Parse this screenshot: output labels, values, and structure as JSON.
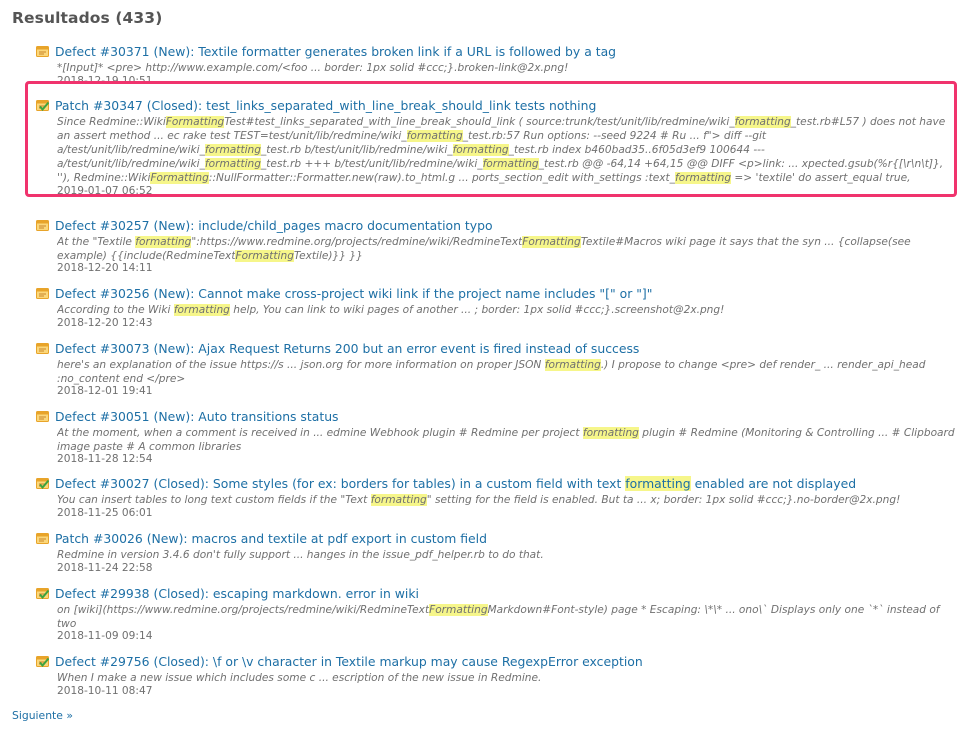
{
  "heading": "Resultados (433)",
  "results": [
    {
      "type": "issue",
      "title": [
        {
          "t": "Defect #30371 (New): Textile formatter generates broken link if a URL is followed by a tag"
        }
      ],
      "desc": [
        {
          "t": "*[Input]* <pre> http://www.example.com/<foo ... border: 1px solid #ccc;}.broken-link@2x.png!"
        }
      ],
      "date": "2018-12-19 10:51"
    },
    {
      "type": "closed",
      "title": [
        {
          "t": "Patch #30347 (Closed): test_links_separated_with_line_break_should_link tests nothing"
        }
      ],
      "desc": [
        {
          "t": "Since Redmine::Wiki"
        },
        {
          "t": "Formatting",
          "h": true
        },
        {
          "t": "Test#test_links_separated_with_line_break_should_link ( source:trunk/test/unit/lib/redmine/wiki_"
        },
        {
          "t": "formatting",
          "h": true
        },
        {
          "t": "_test.rb#L57 ) does not have an assert method ... ec rake test TEST=test/unit/lib/redmine/wiki_"
        },
        {
          "t": "formatting",
          "h": true
        },
        {
          "t": "_test.rb:57 Run options: --seed 9224 # Ru ... f\"> diff --git a/test/unit/lib/redmine/wiki_"
        },
        {
          "t": "formatting",
          "h": true
        },
        {
          "t": "_test.rb b/test/unit/lib/redmine/wiki_"
        },
        {
          "t": "formatting",
          "h": true
        },
        {
          "t": "_test.rb index b460bad35..6f05d3ef9 100644 --- a/test/unit/lib/redmine/wiki_"
        },
        {
          "t": "formatting",
          "h": true
        },
        {
          "t": "_test.rb +++ b/test/unit/lib/redmine/wiki_"
        },
        {
          "t": "formatting",
          "h": true
        },
        {
          "t": "_test.rb @@ -64,14 +64,15 @@ DIFF <p>link: ... xpected.gsub(%r{[\\r\\n\\t]}, ''), Redmine::Wiki"
        },
        {
          "t": "Formatting",
          "h": true
        },
        {
          "t": "::NullFormatter::Formatter.new(raw).to_html.g ... ports_section_edit with_settings :text_"
        },
        {
          "t": "formatting",
          "h": true
        },
        {
          "t": " => 'textile' do assert_equal true, Redmine::Wiki"
        },
        {
          "t": "Formatting",
          "h": true
        },
        {
          "t": "..."
        }
      ],
      "date": "2019-01-07 06:52"
    },
    {
      "type": "issue",
      "title": [
        {
          "t": "Defect #30257 (New): include/child_pages macro documentation typo"
        }
      ],
      "desc": [
        {
          "t": "At the \"Textile "
        },
        {
          "t": "formatting",
          "h": true
        },
        {
          "t": "\":https://www.redmine.org/projects/redmine/wiki/RedmineText"
        },
        {
          "t": "Formatting",
          "h": true
        },
        {
          "t": "Textile#Macros wiki page it says that the syn ... {collapse(see example) {{include(RedmineText"
        },
        {
          "t": "Formatting",
          "h": true
        },
        {
          "t": "Textile)}} }}"
        }
      ],
      "date": "2018-12-20 14:11"
    },
    {
      "type": "issue",
      "title": [
        {
          "t": "Defect #30256 (New): Cannot make cross-project wiki link if the project name includes \"[\" or \"]\""
        }
      ],
      "desc": [
        {
          "t": "According to the Wiki "
        },
        {
          "t": "formatting",
          "h": true
        },
        {
          "t": " help, You can link to wiki pages of another ... ; border: 1px solid #ccc;}.screenshot@2x.png!"
        }
      ],
      "date": "2018-12-20 12:43"
    },
    {
      "type": "issue",
      "title": [
        {
          "t": "Defect #30073 (New): Ajax Request Returns 200 but an error event is fired instead of success"
        }
      ],
      "desc": [
        {
          "t": "here's an explanation of the issue https://s ... json.org for more information on proper JSON "
        },
        {
          "t": "formatting",
          "h": true
        },
        {
          "t": ".) I propose to change <pre> def render_ ... render_api_head :no_content end </pre>"
        }
      ],
      "date": "2018-12-01 19:41"
    },
    {
      "type": "issue",
      "title": [
        {
          "t": "Defect #30051 (New): Auto transitions status"
        }
      ],
      "desc": [
        {
          "t": "At the moment, when a comment is received in ... edmine Webhook plugin # Redmine per project "
        },
        {
          "t": "formatting",
          "h": true
        },
        {
          "t": " plugin # Redmine (Monitoring & Controlling ... # Clipboard image paste # A common libraries"
        }
      ],
      "date": "2018-11-28 12:54"
    },
    {
      "type": "closed",
      "title": [
        {
          "t": "Defect #30027 (Closed): Some styles (for ex: borders for tables) in a custom field with text "
        },
        {
          "t": "formatting",
          "h": true
        },
        {
          "t": " enabled are not displayed"
        }
      ],
      "desc": [
        {
          "t": "You can insert tables to long text custom fields if the \"Text "
        },
        {
          "t": "formatting",
          "h": true
        },
        {
          "t": "\" setting for the field is enabled. But ta ... x; border: 1px solid #ccc;}.no-border@2x.png!"
        }
      ],
      "date": "2018-11-25 06:01"
    },
    {
      "type": "issue",
      "title": [
        {
          "t": "Patch #30026 (New): macros and textile at pdf export in custom field"
        }
      ],
      "desc": [
        {
          "t": "Redmine in version 3.4.6 don't fully support ... hanges in the issue_pdf_helper.rb to do that."
        }
      ],
      "date": "2018-11-24 22:58"
    },
    {
      "type": "closed",
      "title": [
        {
          "t": "Defect #29938 (Closed): escaping markdown. error in wiki"
        }
      ],
      "desc": [
        {
          "t": "on [wiki](https://www.redmine.org/projects/redmine/wiki/RedmineText"
        },
        {
          "t": "Formatting",
          "h": true
        },
        {
          "t": "Markdown#Font-style) page * Escaping: \\*\\* ... ono\\` Displays only one `*` instead of two"
        }
      ],
      "date": "2018-11-09 09:14"
    },
    {
      "type": "closed",
      "title": [
        {
          "t": "Defect #29756 (Closed): \\f or \\v character in Textile markup may cause RegexpError exception"
        }
      ],
      "desc": [
        {
          "t": "When I make a new issue which includes some c ... escription of the new issue in Redmine."
        }
      ],
      "date": "2018-10-11 08:47"
    }
  ],
  "next_link": "Siguiente »",
  "colors": {
    "link": "#1d6fa5",
    "highlight": "#f6f68a",
    "callout_border": "#f0336d",
    "icon_issue": "#e8a42a",
    "icon_closed_check": "#3fa33f"
  },
  "icons": {
    "issue": "issue-icon",
    "closed": "issue-closed-icon"
  }
}
